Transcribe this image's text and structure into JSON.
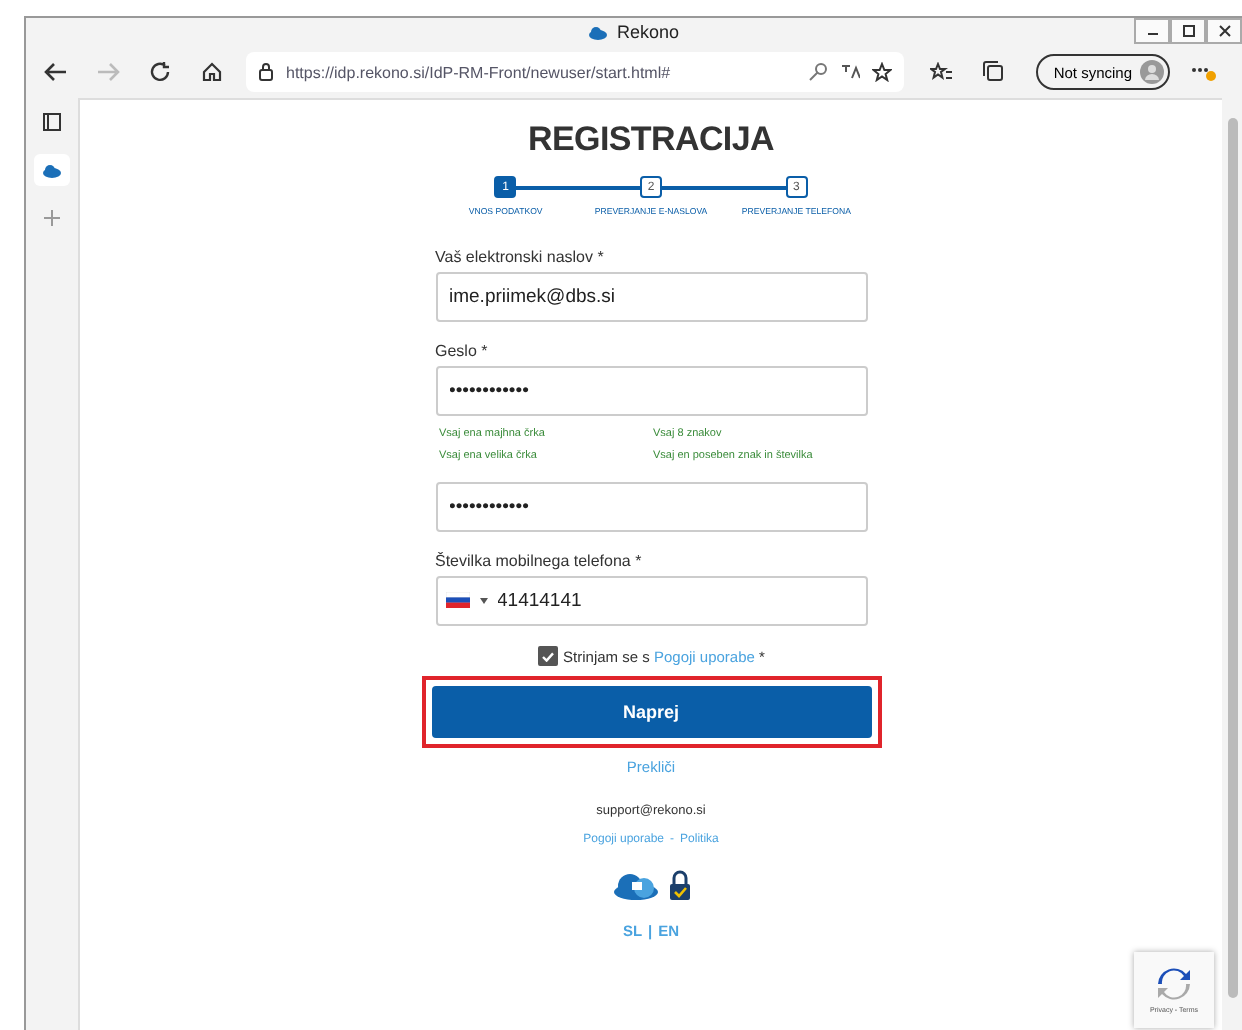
{
  "window": {
    "title": "Rekono"
  },
  "browser": {
    "url": "https://idp.rekono.si/IdP-RM-Front/newuser/start.html#",
    "sync_label": "Not syncing"
  },
  "page": {
    "title": "REGISTRACIJA",
    "steps": [
      {
        "number": "1",
        "label": "VNOS PODATKOV",
        "selected": true
      },
      {
        "number": "2",
        "label": "PREVERJANJE E-NASLOVA",
        "selected": false
      },
      {
        "number": "3",
        "label": "PREVERJANJE TELEFONA",
        "selected": false
      }
    ],
    "email": {
      "label": "Vaš elektronski naslov *",
      "value": "ime.priimek@dbs.si"
    },
    "password": {
      "label": "Geslo *",
      "value": "••••••••••••"
    },
    "password_rules": [
      {
        "text": "Vsaj ena majhna črka",
        "met": true
      },
      {
        "text": "Vsaj 8 znakov",
        "met": true
      },
      {
        "text": "Vsaj ena velika črka",
        "met": true
      },
      {
        "text": "Vsaj en poseben znak in številka",
        "met": true
      }
    ],
    "password_repeat": {
      "value": "••••••••••••"
    },
    "phone": {
      "label": "Številka mobilnega telefona *",
      "value": "41414141"
    },
    "terms": {
      "checked": true,
      "before": "Strinjam se s ",
      "link": "Pogoji uporabe",
      "after": " *"
    },
    "submit": {
      "label": "Naprej",
      "highlighted": true
    },
    "cancel": "Prekliči",
    "support": "support@rekono.si",
    "footer_links": [
      "Pogoji uporabe",
      "Politika"
    ],
    "footer_separator": "-",
    "languages": [
      "SL",
      "EN"
    ],
    "language_separator": "|",
    "recaptcha": "Privacy - Terms"
  }
}
